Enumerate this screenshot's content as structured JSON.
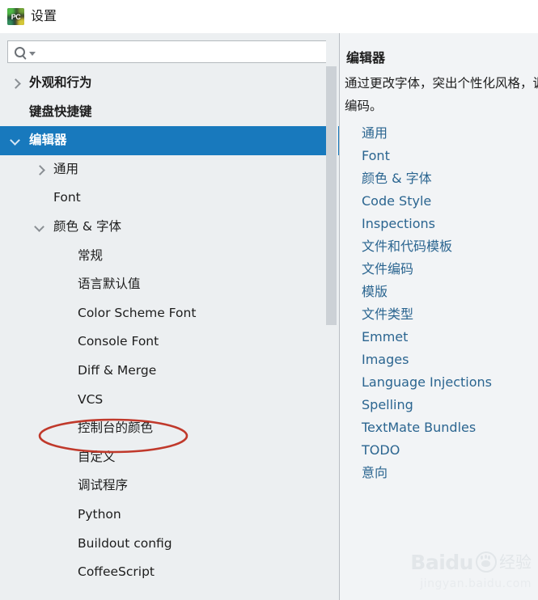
{
  "window": {
    "title": "设置",
    "app_icon": "pycharm-icon",
    "app_icon_text": "PC"
  },
  "search": {
    "value": "",
    "placeholder": "",
    "icon": "search-icon",
    "dropdown_icon": "chevron-down-icon"
  },
  "sidebar": {
    "items": [
      {
        "label": "外观和行为",
        "indent": 0,
        "twisty": "right",
        "bold": true,
        "selected": false
      },
      {
        "label": "键盘快捷键",
        "indent": 0,
        "twisty": "none",
        "bold": true,
        "selected": false
      },
      {
        "label": "编辑器",
        "indent": 0,
        "twisty": "down",
        "bold": true,
        "selected": true
      },
      {
        "label": "通用",
        "indent": 1,
        "twisty": "right",
        "bold": false,
        "selected": false
      },
      {
        "label": "Font",
        "indent": 1,
        "twisty": "none",
        "bold": false,
        "selected": false
      },
      {
        "label": "颜色 & 字体",
        "indent": 1,
        "twisty": "down",
        "bold": false,
        "selected": false
      },
      {
        "label": "常规",
        "indent": 2,
        "twisty": "none",
        "bold": false,
        "selected": false
      },
      {
        "label": "语言默认值",
        "indent": 2,
        "twisty": "none",
        "bold": false,
        "selected": false
      },
      {
        "label": "Color Scheme Font",
        "indent": 2,
        "twisty": "none",
        "bold": false,
        "selected": false
      },
      {
        "label": "Console Font",
        "indent": 2,
        "twisty": "none",
        "bold": false,
        "selected": false
      },
      {
        "label": "Diff & Merge",
        "indent": 2,
        "twisty": "none",
        "bold": false,
        "selected": false
      },
      {
        "label": "VCS",
        "indent": 2,
        "twisty": "none",
        "bold": false,
        "selected": false
      },
      {
        "label": "控制台的颜色",
        "indent": 2,
        "twisty": "none",
        "bold": false,
        "selected": false
      },
      {
        "label": "自定义",
        "indent": 2,
        "twisty": "none",
        "bold": false,
        "selected": false
      },
      {
        "label": "调试程序",
        "indent": 2,
        "twisty": "none",
        "bold": false,
        "selected": false
      },
      {
        "label": "Python",
        "indent": 2,
        "twisty": "none",
        "bold": false,
        "selected": false
      },
      {
        "label": "Buildout config",
        "indent": 2,
        "twisty": "none",
        "bold": false,
        "selected": false
      },
      {
        "label": "CoffeeScript",
        "indent": 2,
        "twisty": "none",
        "bold": false,
        "selected": false
      }
    ]
  },
  "detail": {
    "title": "编辑器",
    "description_line1": "通过更改字体，突出个性化风格，调整代码",
    "description_line2": "编码。",
    "links": [
      "通用",
      "Font",
      "颜色 & 字体",
      "Code Style",
      "Inspections",
      "文件和代码模板",
      "文件编码",
      "模版",
      "文件类型",
      "Emmet",
      "Images",
      "Language Injections",
      "Spelling",
      "TextMate Bundles",
      "TODO",
      "意向"
    ]
  },
  "annotation": {
    "target_label": "控制台的颜色",
    "shape": "ellipse",
    "color": "#c0392b"
  },
  "watermark": {
    "brand": "Baidu",
    "suffix": "经验",
    "url": "jingyan.baidu.com"
  },
  "colors": {
    "selection": "#1879bd",
    "panel_bg": "#eceff1",
    "detail_bg": "#f2f4f6",
    "link": "#2b6590",
    "annotation": "#c0392b"
  }
}
